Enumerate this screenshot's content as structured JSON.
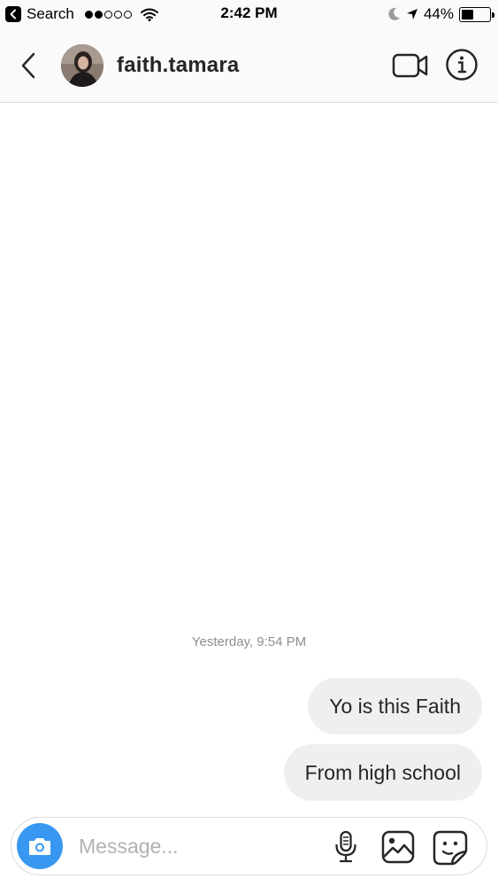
{
  "status_bar": {
    "back_app_label": "Search",
    "time": "2:42 PM",
    "battery_text": "44%",
    "battery_level": 0.44,
    "signal_bars_filled": 2,
    "signal_bars_total": 5
  },
  "header": {
    "username": "faith.tamara"
  },
  "conversation": {
    "timestamp": "Yesterday, 9:54 PM",
    "messages": [
      {
        "text": "Yo is this Faith",
        "sender": "me"
      },
      {
        "text": "From high school",
        "sender": "me"
      }
    ]
  },
  "composer": {
    "placeholder": "Message..."
  },
  "colors": {
    "accent": "#3897f0",
    "bubble": "#efefef",
    "header_bg": "#fafafa",
    "divider": "#dbdbdb",
    "timestamp": "#8e8e8e"
  },
  "icons": [
    "back-arrow-icon",
    "video-call-icon",
    "info-icon",
    "camera-icon",
    "microphone-icon",
    "gallery-icon",
    "sticker-icon",
    "wifi-icon",
    "location-arrow-icon",
    "moon-icon"
  ]
}
